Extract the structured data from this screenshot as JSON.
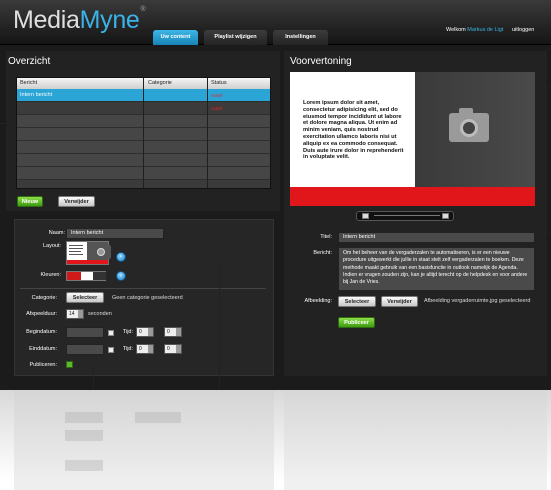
{
  "app": {
    "logo_main": "Media",
    "logo_accent": "Myne",
    "logo_mark": "®"
  },
  "nav": {
    "tabs": [
      {
        "label": "Uw content",
        "active": true
      },
      {
        "label": "Playlist wijzigen",
        "active": false
      },
      {
        "label": "Instellingen",
        "active": false
      }
    ],
    "welcome": "Welkom",
    "user": "Markus de Ligt",
    "logout": "uitloggen"
  },
  "overview": {
    "title": "Overzicht",
    "columns": [
      "Bericht",
      "Categorie",
      "Status"
    ],
    "rows": [
      {
        "bericht": "Intern bericht",
        "categorie": "",
        "status": "Actief",
        "selected": true
      },
      {
        "bericht": "",
        "categorie": "",
        "status": "Actief",
        "selected": false
      },
      {
        "bericht": "",
        "categorie": "",
        "status": "",
        "selected": false
      },
      {
        "bericht": "",
        "categorie": "",
        "status": "",
        "selected": false
      },
      {
        "bericht": "",
        "categorie": "",
        "status": "",
        "selected": false
      },
      {
        "bericht": "",
        "categorie": "",
        "status": "",
        "selected": false
      },
      {
        "bericht": "",
        "categorie": "",
        "status": "",
        "selected": false
      }
    ],
    "new_button": "Nieuw",
    "delete_button": "Verwijder"
  },
  "form": {
    "naam_label": "Naam:",
    "naam_value": "Intern bericht",
    "layout_label": "Layout:",
    "kleuren_label": "Kleuren:",
    "categorie_label": "Categorie:",
    "select_button": "Selecteer",
    "categorie_status": "Geen categorie geselecteerd",
    "afspeelduur_label": "Afspeelduur:",
    "afspeelduur_value": "14",
    "afspeelduur_unit": "seconden",
    "begindatum_label": "Begindatum:",
    "einddatum_label": "Einddatum:",
    "tijd_label": "Tijd:",
    "time_hour": "0",
    "time_min": "0",
    "publiceren_label": "Publiceren:"
  },
  "preview": {
    "title": "Voorvertoning",
    "body_text": "Lorem ipsum dolor sit amet, consectetur adipisicing elit, sed do eiusmod tempor incididunt ut labore et dolore magna aliqua. Ut enim ad minim veniam, quis nostrud exercitation ullamco laboris nisi ut aliquip ex ea commodo consequat. Duis aute irure dolor in reprehenderit in voluptate velit.",
    "titel_label": "Titel:",
    "titel_value": "Intern bericht",
    "bericht_label": "Bericht:",
    "bericht_value": "Om het beheer van de vergaderzalen te automatiseren, is er een nieuwe procedure uitgewerkt die jullie in staat stelt zelf vergaderzalen te boeken. Deze methode maakt gebruik van een basisfunctie in outlook namelijk de Agenda. Indien er vragen zouden zijn, kan je altijd terecht op de helpdesk en voor andere bij Jan de Vries.",
    "afbeelding_label": "Afbeelding:",
    "select_button": "Selecteer",
    "delete_button": "Verwijder",
    "image_status": "Afbeelding vergaderruimte.jpg geselecteerd",
    "publish_button": "Publiceer"
  },
  "colors": {
    "accent": "#2aa5d6",
    "status_red": "#e22222",
    "preview_red": "#e0161a",
    "green_button": "#4caf1c"
  }
}
